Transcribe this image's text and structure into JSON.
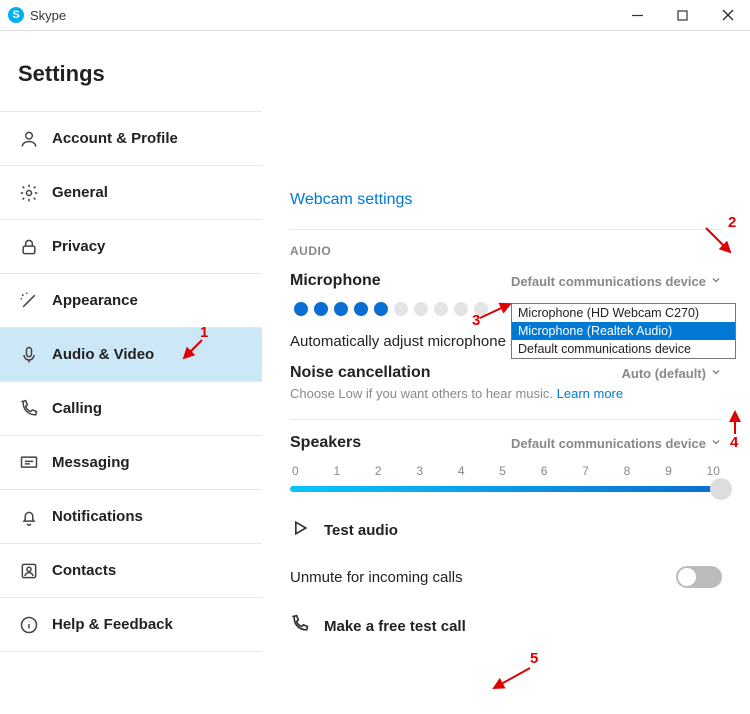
{
  "app": {
    "title": "Skype"
  },
  "sidebar": {
    "heading": "Settings",
    "items": [
      {
        "label": "Account & Profile"
      },
      {
        "label": "General"
      },
      {
        "label": "Privacy"
      },
      {
        "label": "Appearance"
      },
      {
        "label": "Audio & Video"
      },
      {
        "label": "Calling"
      },
      {
        "label": "Messaging"
      },
      {
        "label": "Notifications"
      },
      {
        "label": "Contacts"
      },
      {
        "label": "Help & Feedback"
      }
    ]
  },
  "main": {
    "webcam_link": "Webcam settings",
    "audio_section": "AUDIO",
    "mic_label": "Microphone",
    "mic_device": "Default communications device",
    "mic_options": [
      "Microphone (HD Webcam C270)",
      "Microphone (Realtek Audio)",
      "Default communications device"
    ],
    "mic_level": 5,
    "mic_total": 10,
    "auto_adjust": "Automatically adjust microphone settings",
    "noise_label": "Noise cancellation",
    "noise_value": "Auto (default)",
    "noise_hint": "Choose Low if you want others to hear music. ",
    "learn_more": "Learn more",
    "speakers_label": "Speakers",
    "speakers_device": "Default communications device",
    "speaker_scale": [
      "0",
      "1",
      "2",
      "3",
      "4",
      "5",
      "6",
      "7",
      "8",
      "9",
      "10"
    ],
    "speaker_value": 10,
    "test_audio": "Test audio",
    "unmute": "Unmute for incoming calls",
    "test_call": "Make a free test call"
  },
  "annotations": {
    "a1": "1",
    "a2": "2",
    "a3": "3",
    "a4": "4",
    "a5": "5"
  }
}
